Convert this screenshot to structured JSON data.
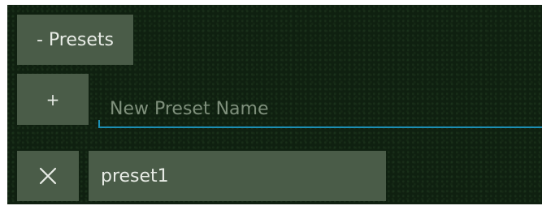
{
  "presets_panel": {
    "toggle_label": "- Presets",
    "add_label": "+",
    "new_name_placeholder": "New Preset Name",
    "new_name_value": "",
    "items": [
      {
        "name": "preset1",
        "delete_icon": "close-icon"
      }
    ]
  },
  "colors": {
    "background": "#0f2010",
    "button": "#4a5c48",
    "text": "#e8ece6",
    "placeholder": "#7f907c",
    "accent": "#1c8fb4"
  }
}
